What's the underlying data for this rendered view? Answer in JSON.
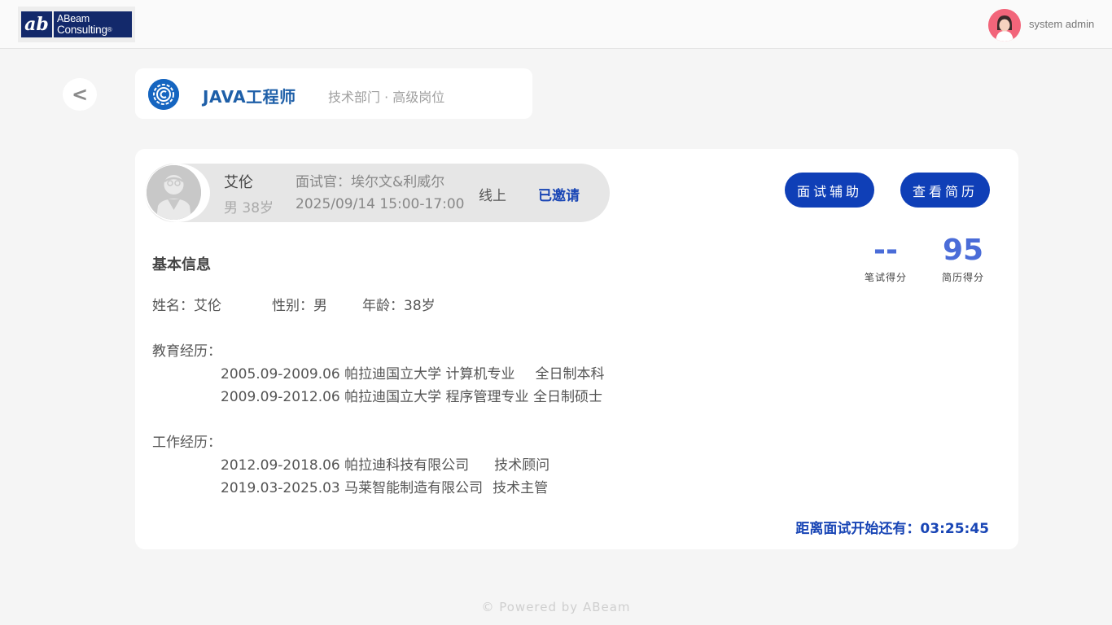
{
  "header": {
    "logo": {
      "brand_line1": "ABeam",
      "brand_line2": "Consulting",
      "registered": "®"
    },
    "user": {
      "name": "system admin",
      "avatar_icon": "user-avatar-icon"
    }
  },
  "job": {
    "back_label": "<",
    "title": "JAVA工程师",
    "subtitle": "技术部门 · 高级岗位"
  },
  "candidate": {
    "name": "艾伦",
    "meta": "男 38岁",
    "interviewer": "面试官：埃尔文&利威尔",
    "time": "2025/09/14 15:00-17:00",
    "mode": "线上",
    "status": "已邀请"
  },
  "actions": {
    "assist_label": "面试辅助",
    "resume_label": "查看简历"
  },
  "scores": {
    "written_value": "--",
    "written_label": "笔试得分",
    "resume_value": "95",
    "resume_label": "简历得分"
  },
  "basic_info": {
    "section_title": "基本信息",
    "name": "姓名：艾伦",
    "gender": "性别：男",
    "age": "年龄：38岁"
  },
  "education": {
    "heading": "教育经历：",
    "items": [
      {
        "period": "2005.09-2009.06",
        "school": "帕拉迪国立大学 计算机专业",
        "degree": "全日制本科"
      },
      {
        "period": "2009.09-2012.06",
        "school": "帕拉迪国立大学 程序管理专业",
        "degree": "全日制硕士"
      }
    ]
  },
  "work": {
    "heading": "工作经历：",
    "items": [
      {
        "period": "2012.09-2018.06",
        "company": "帕拉迪科技有限公司",
        "role": "技术顾问"
      },
      {
        "period": "2019.03-2025.03",
        "company": "马莱智能制造有限公司",
        "role": "技术主管"
      }
    ]
  },
  "countdown": "距离面试开始还有：03:25:45",
  "footer": "© Powered by ABeam",
  "colors": {
    "primary": "#0f3fb7",
    "score": "#4a6cd8",
    "title": "#1e5fa8"
  }
}
